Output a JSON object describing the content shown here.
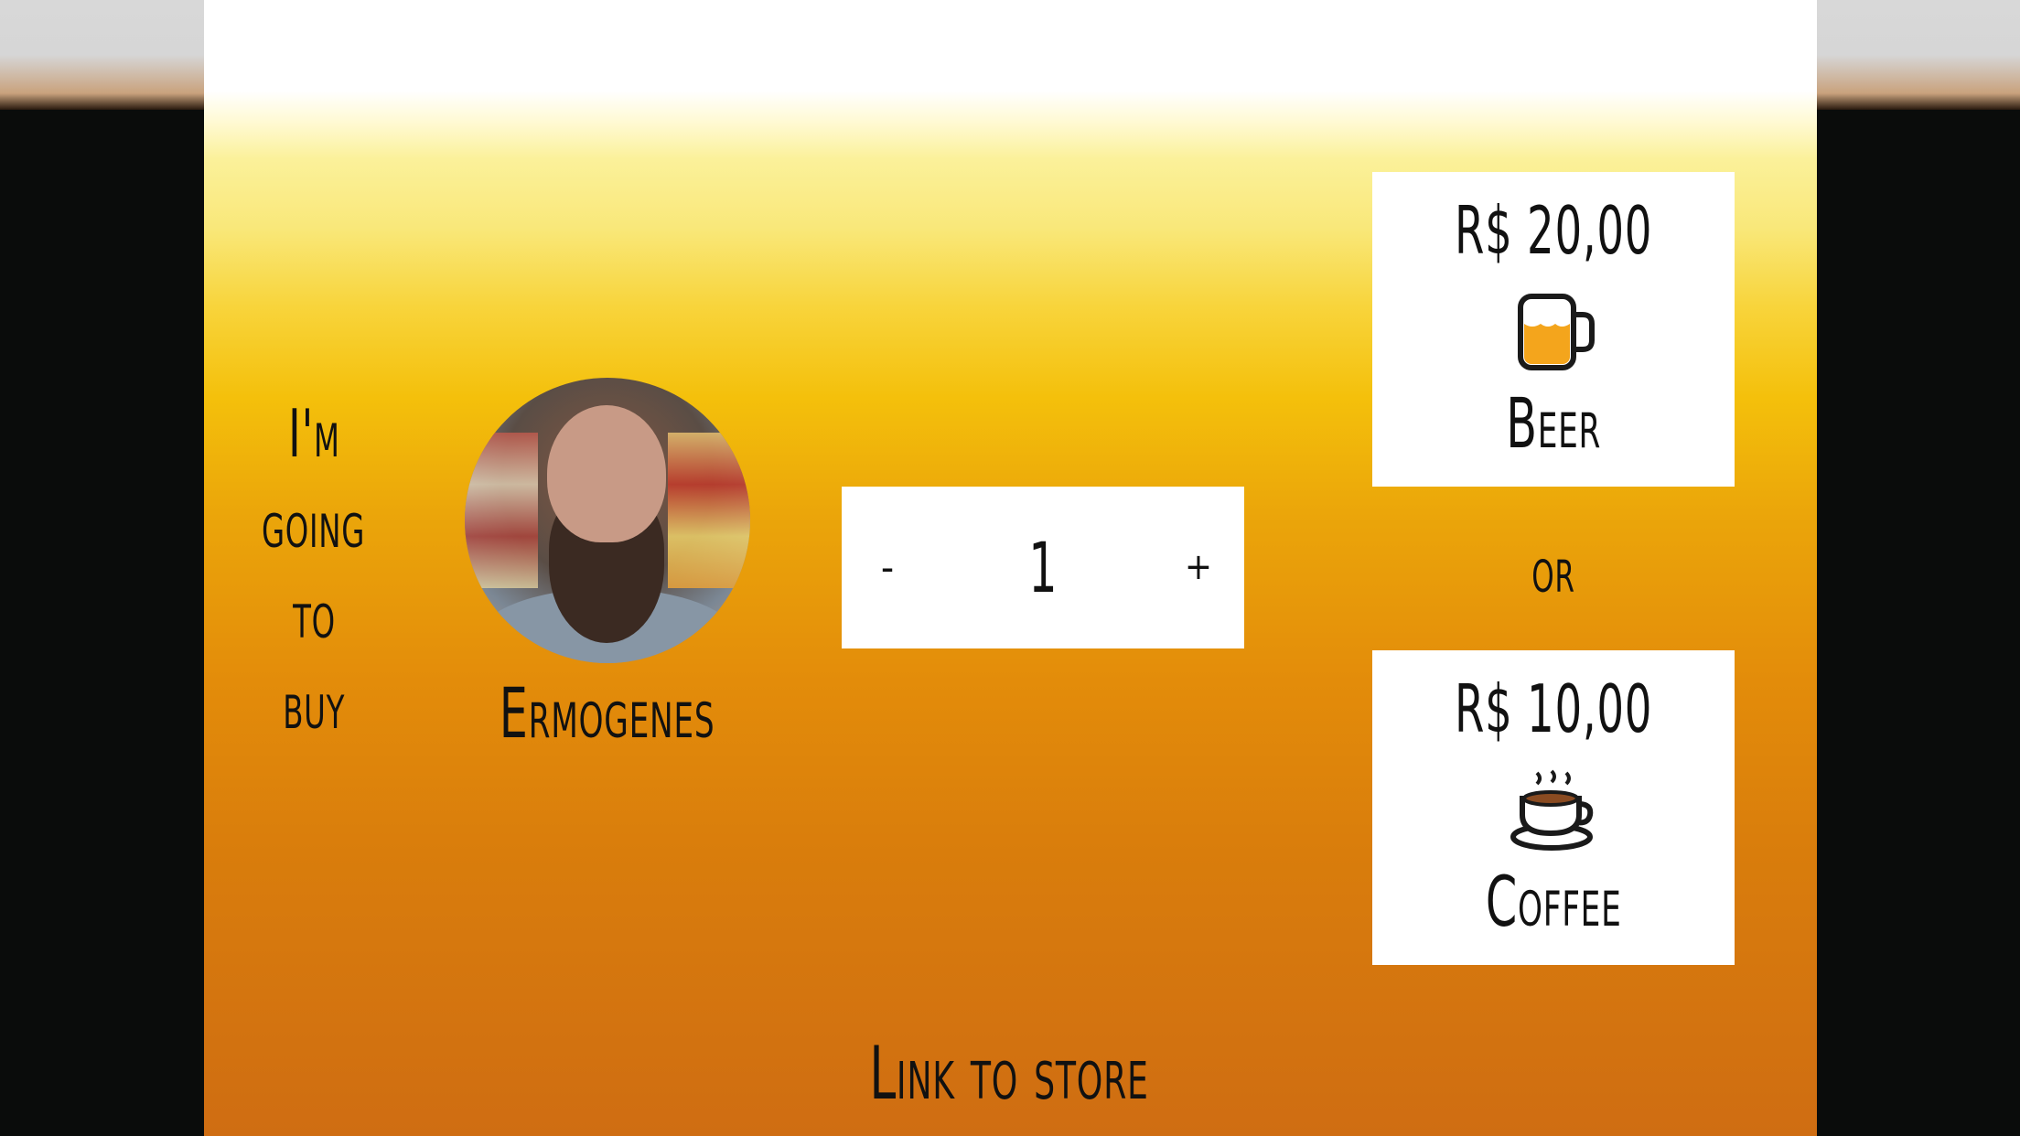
{
  "intro": {
    "lines": [
      "I'm",
      "going",
      "to",
      "buy"
    ]
  },
  "recipient": {
    "name": "Ermogenes",
    "avatar_icon": "profile-photo"
  },
  "quantity": {
    "decrement_label": "-",
    "value": "1",
    "increment_label": "+"
  },
  "options": {
    "beer": {
      "price": "R$ 20,00",
      "icon": "beer-mug-icon",
      "label": "Beer"
    },
    "separator": "or",
    "coffee": {
      "price": "R$ 10,00",
      "icon": "coffee-cup-icon",
      "label": "Coffee"
    }
  },
  "footer": {
    "store_link": "Link to store"
  },
  "colors": {
    "background_top": "#ffffff",
    "background_mid": "#f4c00b",
    "background_bottom": "#cf6d12",
    "card": "#ffffff",
    "text": "#111111",
    "outer": "#0a0c0b"
  }
}
